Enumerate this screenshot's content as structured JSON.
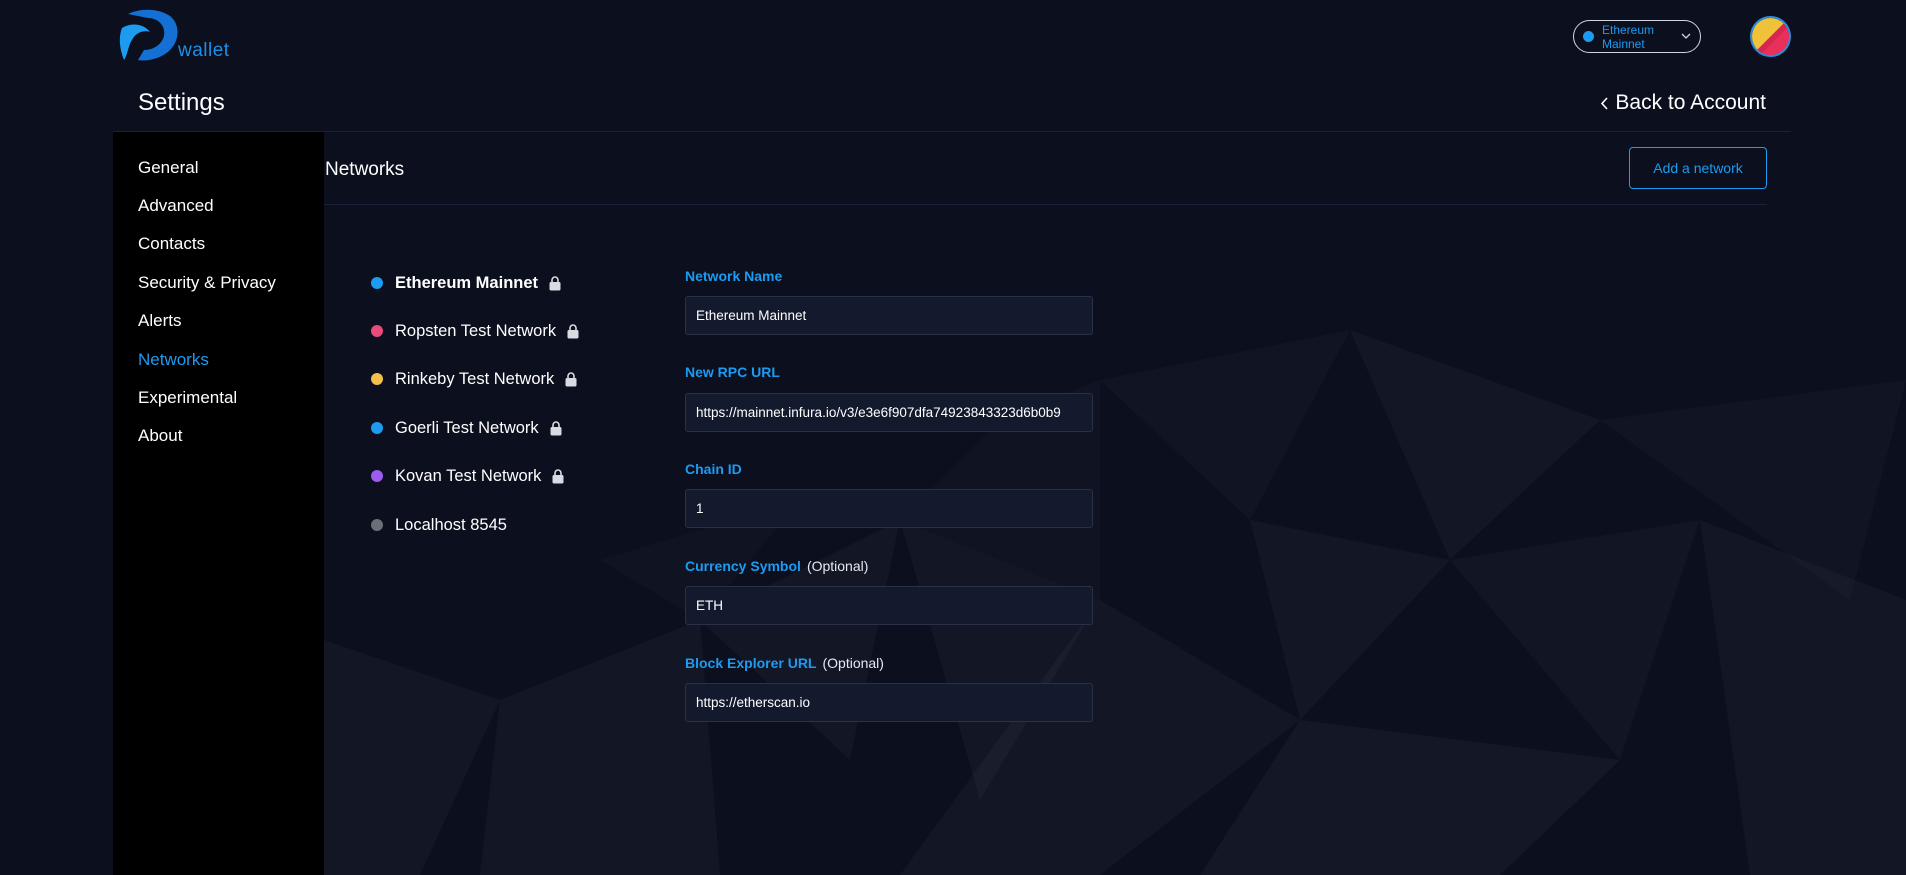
{
  "header": {
    "logo_text": "wallet",
    "network_selector": "Ethereum Mainnet"
  },
  "settings": {
    "title": "Settings",
    "back_label": "Back to Account"
  },
  "sidebar": {
    "items": [
      {
        "label": "General",
        "active": false
      },
      {
        "label": "Advanced",
        "active": false
      },
      {
        "label": "Contacts",
        "active": false
      },
      {
        "label": "Security & Privacy",
        "active": false
      },
      {
        "label": "Alerts",
        "active": false
      },
      {
        "label": "Networks",
        "active": true
      },
      {
        "label": "Experimental",
        "active": false
      },
      {
        "label": "About",
        "active": false
      }
    ]
  },
  "networks": {
    "title": "Networks",
    "add_button": "Add a network",
    "list": [
      {
        "label": "Ethereum Mainnet",
        "color": "#1d9bf0",
        "locked": true,
        "selected": true
      },
      {
        "label": "Ropsten Test Network",
        "color": "#ea4b7b",
        "locked": true,
        "selected": false
      },
      {
        "label": "Rinkeby Test Network",
        "color": "#f3c04c",
        "locked": true,
        "selected": false
      },
      {
        "label": "Goerli Test Network",
        "color": "#1d9bf0",
        "locked": true,
        "selected": false
      },
      {
        "label": "Kovan Test Network",
        "color": "#9b5cf0",
        "locked": true,
        "selected": false
      },
      {
        "label": "Localhost 8545",
        "color": "#6b7078",
        "locked": false,
        "selected": false
      }
    ]
  },
  "form": {
    "network_name": {
      "label": "Network Name",
      "value": "Ethereum Mainnet"
    },
    "rpc_url": {
      "label": "New RPC URL",
      "value": "https://mainnet.infura.io/v3/e3e6f907dfa74923843323d6b0b9"
    },
    "chain_id": {
      "label": "Chain ID",
      "value": "1"
    },
    "currency_symbol": {
      "label": "Currency Symbol",
      "optional": "(Optional)",
      "value": "ETH"
    },
    "block_explorer": {
      "label": "Block Explorer URL",
      "optional": "(Optional)",
      "value": "https://etherscan.io"
    }
  },
  "colors": {
    "accent": "#1d9bf0",
    "background": "#0b0f1e",
    "sidebar": "#000000",
    "input_bg": "#141a2e"
  }
}
